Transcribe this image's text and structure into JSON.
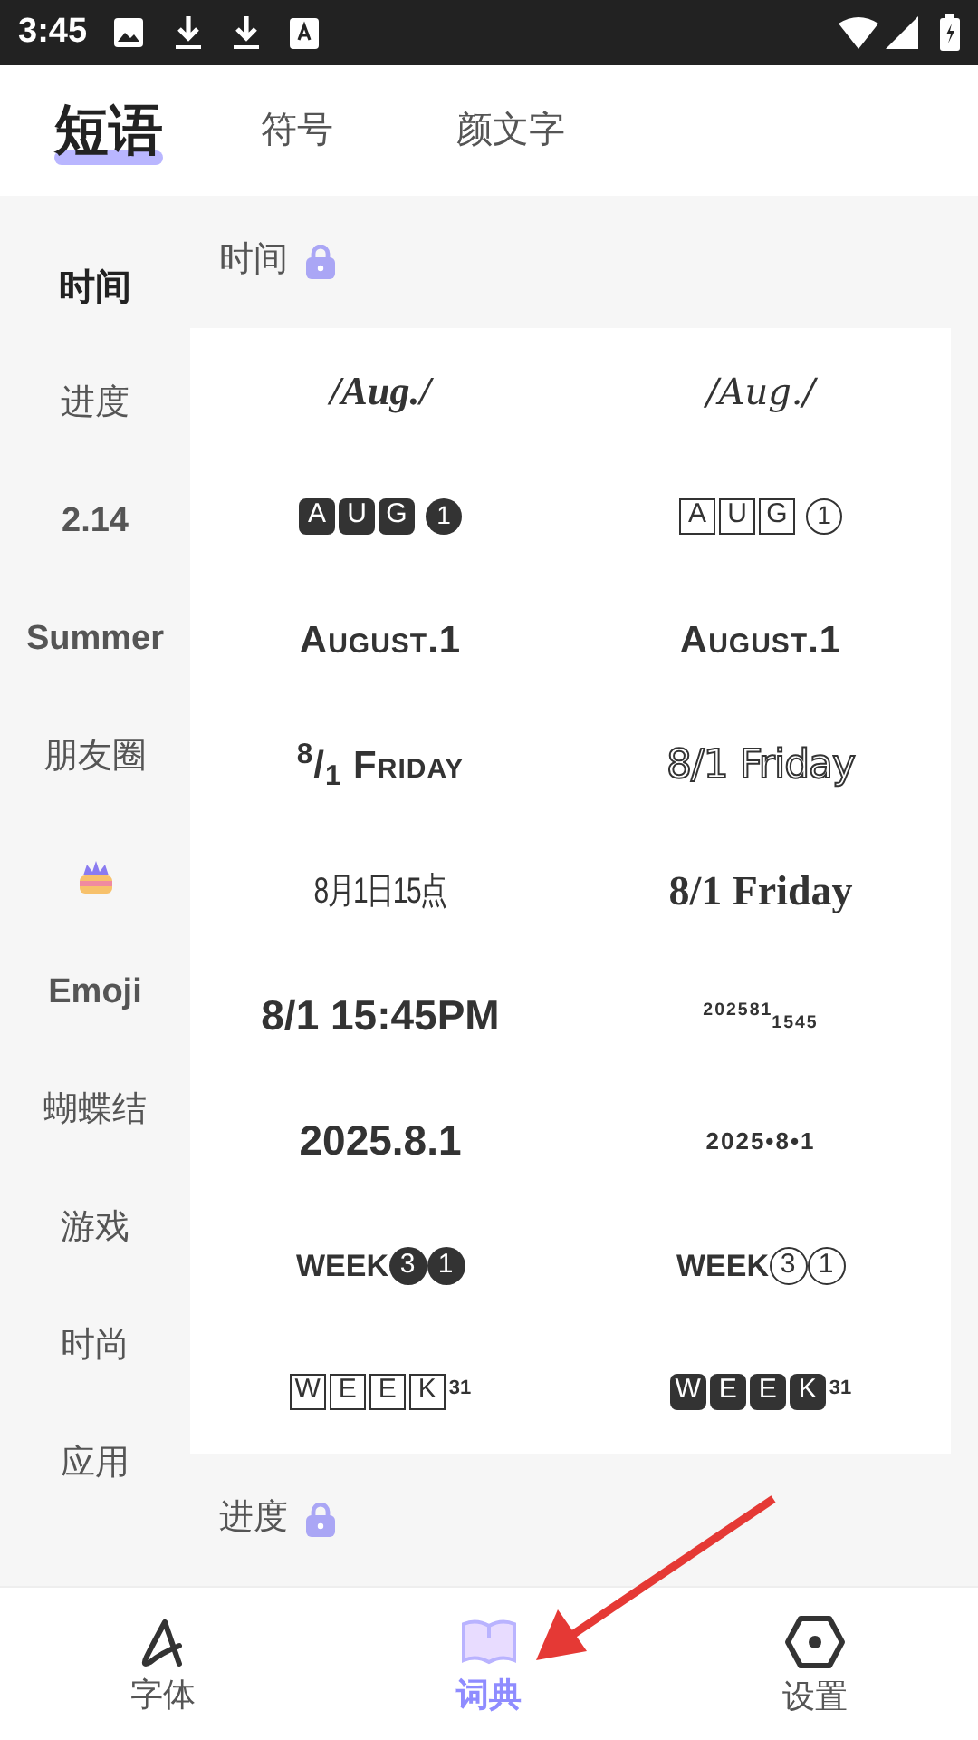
{
  "status_bar": {
    "time": "3:45"
  },
  "top_tabs": [
    {
      "label": "短语",
      "selected": true
    },
    {
      "label": "符号",
      "selected": false
    },
    {
      "label": "颜文字",
      "selected": false
    }
  ],
  "sidebar": {
    "items": [
      {
        "kind": "text",
        "label": "时间",
        "selected": true
      },
      {
        "kind": "text",
        "label": "进度",
        "selected": false
      },
      {
        "kind": "text",
        "label": "2.14",
        "selected": false
      },
      {
        "kind": "text",
        "label": "Summer",
        "selected": false
      },
      {
        "kind": "text",
        "label": "朋友圈",
        "selected": false
      },
      {
        "kind": "icon",
        "selected": false
      },
      {
        "kind": "text",
        "label": "Emoji",
        "selected": false
      },
      {
        "kind": "text",
        "label": "蝴蝶结",
        "selected": false
      },
      {
        "kind": "text",
        "label": "游戏",
        "selected": false
      },
      {
        "kind": "text",
        "label": "时尚",
        "selected": false
      },
      {
        "kind": "text",
        "label": "应用",
        "selected": false
      }
    ]
  },
  "sections": [
    {
      "title": "时间",
      "locked": true,
      "phrases": [
        {
          "kind": "serif-italic",
          "text": "/Aug./"
        },
        {
          "kind": "script",
          "text": "/Aug./"
        },
        {
          "kind": "dark-boxes",
          "text": "A U G",
          "suffix": "1"
        },
        {
          "kind": "outline-boxes",
          "text": "A U G",
          "suffix": "1"
        },
        {
          "kind": "small-caps",
          "text": "August.1"
        },
        {
          "kind": "small-caps",
          "text": "August.1"
        },
        {
          "kind": "small-caps",
          "text": "$^{8}$/$_{1}$ Friday"
        },
        {
          "kind": "outline",
          "text": "8/1 Friday"
        },
        {
          "kind": "condensed",
          "text": "8月1日15点"
        },
        {
          "kind": "serif-bold",
          "text": "8/1 Friday"
        },
        {
          "kind": "bold",
          "text": "8/1 15:45PM"
        },
        {
          "kind": "tiny-bold",
          "text": "$^{202581}$$_{1545}$"
        },
        {
          "kind": "bold",
          "text": "2025.8.1"
        },
        {
          "kind": "tiny-bold",
          "text": "2025•8•1"
        },
        {
          "kind": "week-dark-circles",
          "text": "WEEK",
          "suffix": "3 1"
        },
        {
          "kind": "week-outline-circles",
          "text": "WEEK",
          "suffix": "3 1"
        },
        {
          "kind": "outline-boxes",
          "text": "W E E K",
          "suffix": "31"
        },
        {
          "kind": "dark-boxes",
          "text": "W E E K",
          "suffix": "31"
        }
      ]
    },
    {
      "title": "进度",
      "locked": true
    }
  ],
  "bottom_nav": [
    {
      "label": "字体",
      "selected": false
    },
    {
      "label": "词典",
      "selected": true
    },
    {
      "label": "设置",
      "selected": false
    }
  ]
}
